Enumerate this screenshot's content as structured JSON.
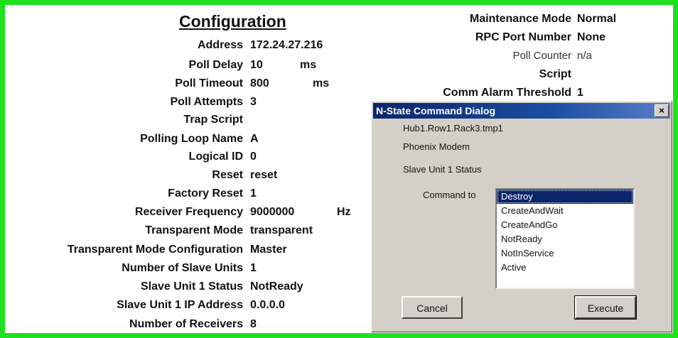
{
  "config": {
    "title": "Configuration",
    "fields": [
      {
        "label": "Address",
        "value": "172.24.27.216",
        "unit": ""
      },
      {
        "label": "Poll Delay",
        "value": "10",
        "unit": "ms"
      },
      {
        "label": "Poll Timeout",
        "value": "800",
        "unit": "ms"
      },
      {
        "label": "Poll Attempts",
        "value": "3",
        "unit": ""
      },
      {
        "label": "Trap Script",
        "value": "",
        "unit": ""
      },
      {
        "label": "Polling Loop Name",
        "value": "A",
        "unit": ""
      },
      {
        "label": "Logical ID",
        "value": "0",
        "unit": ""
      },
      {
        "label": "Reset",
        "value": "reset",
        "unit": ""
      },
      {
        "label": "Factory Reset",
        "value": "1",
        "unit": ""
      },
      {
        "label": "Receiver Frequency",
        "value": "9000000",
        "unit": "Hz"
      },
      {
        "label": "Transparent Mode",
        "value": "transparent",
        "unit": ""
      },
      {
        "label": "Transparent Mode Configuration",
        "value": "Master",
        "unit": ""
      },
      {
        "label": "Number of Slave Units",
        "value": "1",
        "unit": ""
      },
      {
        "label": "Slave Unit 1 Status",
        "value": "NotReady",
        "unit": ""
      },
      {
        "label": "Slave Unit 1 IP Address",
        "value": "0.0.0.0",
        "unit": ""
      },
      {
        "label": "Number of Receivers",
        "value": "8",
        "unit": ""
      }
    ]
  },
  "right_fields": [
    {
      "label": "Maintenance Mode",
      "value": "Normal"
    },
    {
      "label": "RPC Port Number",
      "value": "None"
    },
    {
      "label": "Poll Counter",
      "value": "n/a"
    },
    {
      "label": "Script",
      "value": ""
    },
    {
      "label": "Comm Alarm Threshold",
      "value": "1"
    }
  ],
  "dialog": {
    "title": "N-State Command Dialog",
    "close_label": "×",
    "path": "Hub1.Row1.Rack3.tmp1",
    "device": "Phoenix Modem",
    "variable": "Slave Unit 1 Status",
    "command_label": "Command to",
    "options": [
      "Destroy",
      "CreateAndWait",
      "CreateAndGo",
      "NotReady",
      "NotInService",
      "Active"
    ],
    "selected": "Destroy",
    "cancel_label": "Cancel",
    "execute_label": "Execute"
  },
  "colors": {
    "border": "#1fe01f",
    "titlebar": "#0a246a",
    "selection": "#0a246a"
  }
}
